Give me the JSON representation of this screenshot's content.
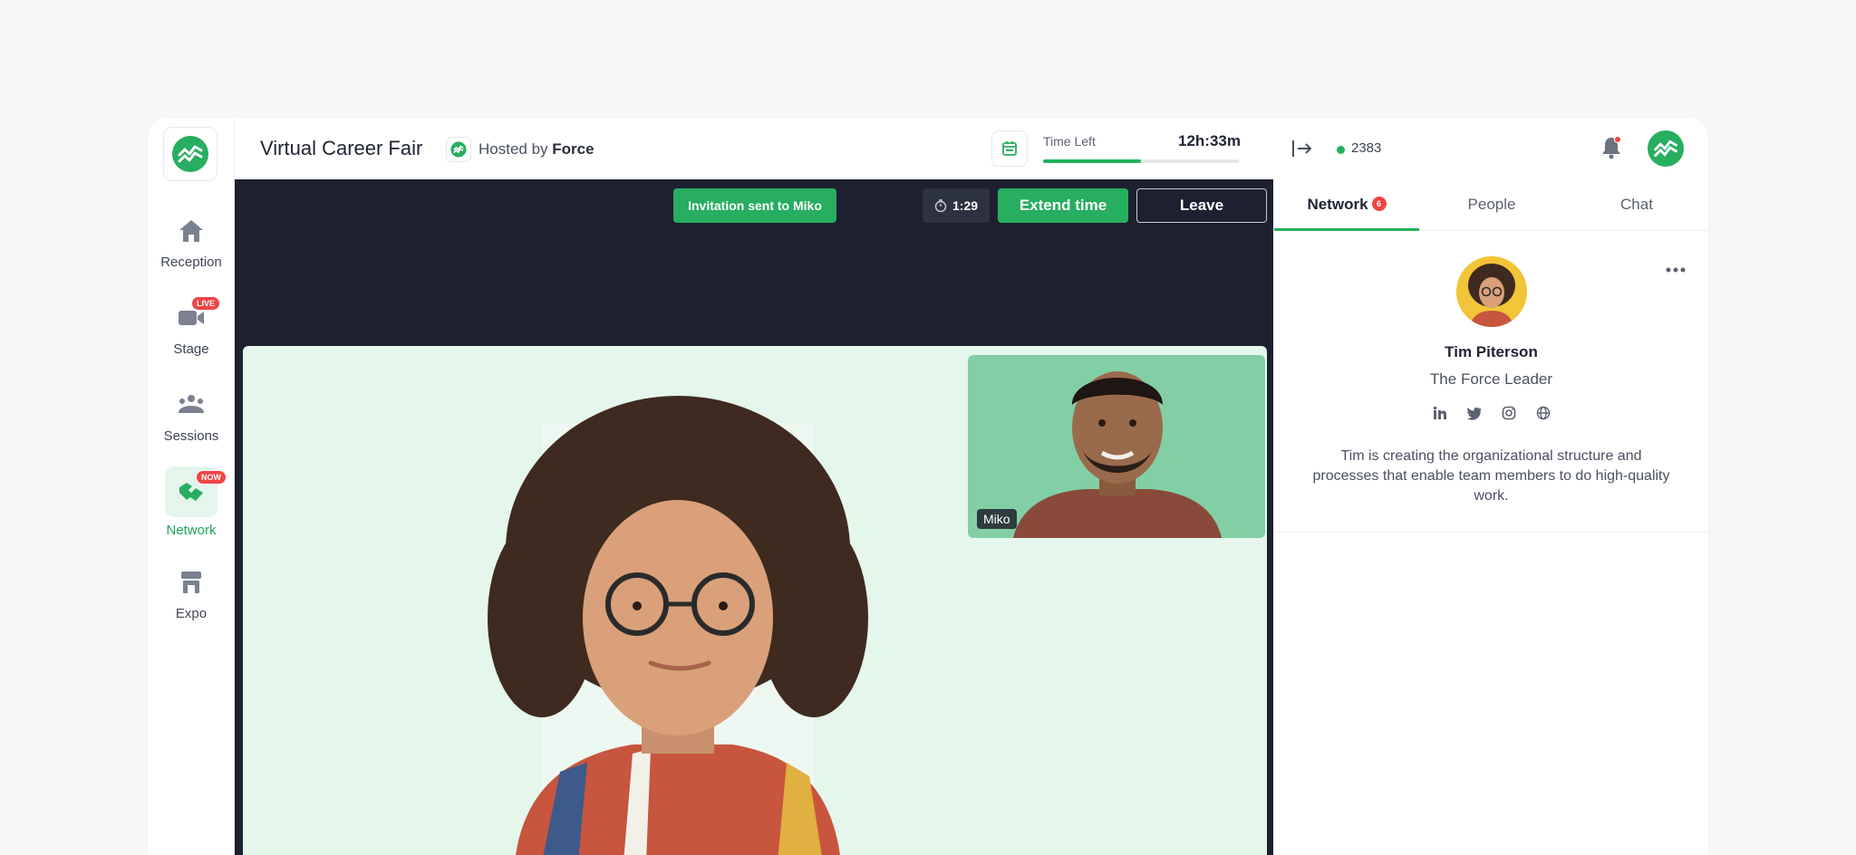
{
  "nav": {
    "items": [
      {
        "label": "Reception",
        "icon": "home-icon"
      },
      {
        "label": "Stage",
        "icon": "video-camera-icon",
        "badge": "LIVE"
      },
      {
        "label": "Sessions",
        "icon": "group-icon"
      },
      {
        "label": "Network",
        "icon": "handshake-icon",
        "badge": "NOW",
        "active": true
      },
      {
        "label": "Expo",
        "icon": "booth-icon"
      }
    ]
  },
  "header": {
    "title": "Virtual Career Fair",
    "hosted_prefix": "Hosted by",
    "host_name": "Force",
    "time_left_label": "Time Left",
    "time_left_value": "12h:33m",
    "time_left_progress": 0.5
  },
  "stage": {
    "toast": "Invitation sent to Miko",
    "timer": "1:29",
    "extend_label": "Extend time",
    "leave_label": "Leave",
    "pip_name": "Miko"
  },
  "panel": {
    "online_count": "2383",
    "tabs": [
      {
        "label": "Network",
        "badge": "6"
      },
      {
        "label": "People"
      },
      {
        "label": "Chat"
      }
    ],
    "profile": {
      "name": "Tim Piterson",
      "role": "The Force Leader",
      "bio": "Tim is creating the organizational structure and processes that enable team members to do high-quality work.",
      "socials": [
        "linkedin-icon",
        "twitter-icon",
        "instagram-icon",
        "globe-icon"
      ]
    }
  },
  "colors": {
    "accent": "#27ae60",
    "stage_bg": "#1c2030",
    "alert": "#ef4444"
  }
}
